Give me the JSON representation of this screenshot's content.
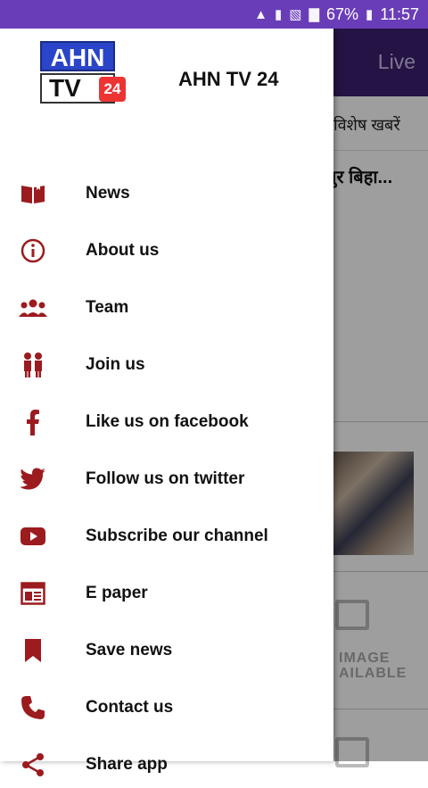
{
  "status_bar": {
    "battery": "67%",
    "time": "11:57"
  },
  "background": {
    "toolbar_live": "Live",
    "tab_label": "विशेष खबरें",
    "headline": "पुर बिहा...",
    "placeholder_text_1": "IMAGE",
    "placeholder_text_2": "AILABLE"
  },
  "drawer": {
    "logo": {
      "top": "AHN",
      "bottom": "TV",
      "badge": "24"
    },
    "title": "AHN TV 24",
    "items": [
      {
        "label": "News",
        "icon": "book-icon"
      },
      {
        "label": "About us",
        "icon": "info-icon"
      },
      {
        "label": "Team",
        "icon": "team-icon"
      },
      {
        "label": "Join us",
        "icon": "people-icon"
      },
      {
        "label": "Like us on facebook",
        "icon": "facebook-icon"
      },
      {
        "label": "Follow us on twitter",
        "icon": "twitter-icon"
      },
      {
        "label": "Subscribe our channel",
        "icon": "youtube-icon"
      },
      {
        "label": "E paper",
        "icon": "newspaper-icon"
      },
      {
        "label": "Save news",
        "icon": "bookmark-icon"
      },
      {
        "label": "Contact us",
        "icon": "phone-icon"
      },
      {
        "label": "Share app",
        "icon": "share-icon"
      }
    ]
  },
  "colors": {
    "status_bar": "#6a3db8",
    "toolbar": "#3a1f6e",
    "icon": "#9b1b1f"
  }
}
